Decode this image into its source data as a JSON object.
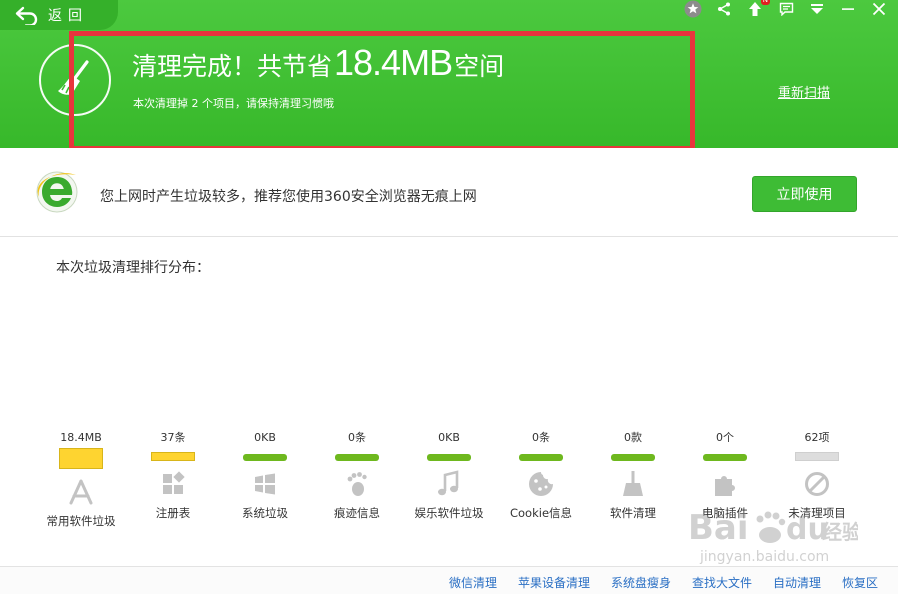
{
  "header": {
    "back_label": "返回",
    "title_prefix": "清理完成！共节省",
    "title_size": "18.4MB",
    "title_suffix": "空间",
    "subtitle": "本次清理掉 2 个项目，请保持清理习惯哦",
    "rescan_label": "重新扫描",
    "notification_badge": "N",
    "accent_color": "#3dbd31"
  },
  "promo": {
    "text": "您上网时产生垃圾较多，推荐您使用360安全浏览器无痕上网",
    "button_label": "立即使用"
  },
  "ranking": {
    "title": "本次垃圾清理排行分布：",
    "categories": [
      {
        "value": "18.4MB",
        "label": "常用软件垃圾",
        "level": "full",
        "color": "#fed430",
        "icon": "app-store-icon"
      },
      {
        "value": "37条",
        "label": "注册表",
        "level": "medium",
        "color": "#fed430",
        "icon": "registry-icon"
      },
      {
        "value": "0KB",
        "label": "系统垃圾",
        "level": "zero",
        "color": "#6eb81e",
        "icon": "windows-icon"
      },
      {
        "value": "0条",
        "label": "痕迹信息",
        "level": "zero",
        "color": "#6eb81e",
        "icon": "footprint-icon"
      },
      {
        "value": "0KB",
        "label": "娱乐软件垃圾",
        "level": "zero",
        "color": "#6eb81e",
        "icon": "music-icon"
      },
      {
        "value": "0条",
        "label": "Cookie信息",
        "level": "zero",
        "color": "#6eb81e",
        "icon": "cookie-icon"
      },
      {
        "value": "0款",
        "label": "软件清理",
        "level": "zero",
        "color": "#6eb81e",
        "icon": "broom-icon"
      },
      {
        "value": "0个",
        "label": "电脑插件",
        "level": "zero",
        "color": "#6eb81e",
        "icon": "plugin-icon"
      },
      {
        "value": "62项",
        "label": "未清理项目",
        "level": "none",
        "color": "#dddddd",
        "icon": "block-icon"
      }
    ]
  },
  "footer": {
    "links": [
      "微信清理",
      "苹果设备清理",
      "系统盘瘦身",
      "查找大文件",
      "自动清理",
      "恢复区"
    ]
  },
  "watermark": {
    "text": "Bai du 经验",
    "url": "jingyan.baidu.com"
  }
}
